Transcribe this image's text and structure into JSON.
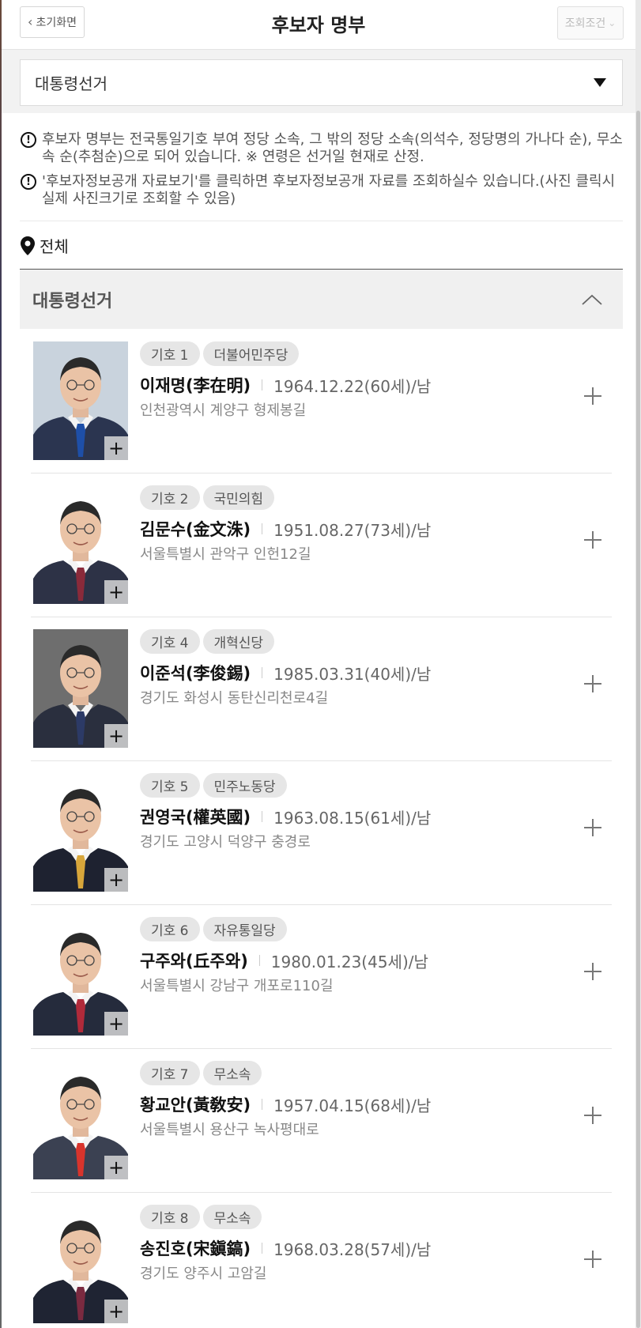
{
  "header": {
    "back_label": "초기화면",
    "title": "후보자 명부",
    "filter_label": "조회조건"
  },
  "election_select": {
    "value": "대통령선거"
  },
  "notices": [
    "후보자 명부는 전국통일기호 부여 정당 소속, 그 밖의 정당 소속(의석수, 정당명의 가나다 순), 무소속 순(추첨순)으로 되어 있습니다. ※ 연령은 선거일 현재로 산정.",
    "'후보자정보공개 자료보기'를 클릭하면 후보자정보공개 자료를 조회하실수 있습니다.(사진 클릭시 실제 사진크기로 조회할 수 있음)"
  ],
  "region": {
    "label": "전체"
  },
  "section": {
    "title": "대통령선거"
  },
  "candidates": [
    {
      "number": "기호 1",
      "party": "더불어민주당",
      "name": "이재명(李在明)",
      "birth": "1964.12.22(60세)/남",
      "address": "인천광역시 계양구 형제봉길",
      "suit": "#2b3550",
      "tie": "#1e4fa8",
      "bg": "#c9d3dd"
    },
    {
      "number": "기호 2",
      "party": "국민의힘",
      "name": "김문수(金文洙)",
      "birth": "1951.08.27(73세)/남",
      "address": "서울특별시 관악구 인헌12길",
      "suit": "#2d3246",
      "tie": "#8a2a3a",
      "bg": "#ffffff"
    },
    {
      "number": "기호 4",
      "party": "개혁신당",
      "name": "이준석(李俊錫)",
      "birth": "1985.03.31(40세)/남",
      "address": "경기도 화성시 동탄신리천로4길",
      "suit": "#2a2f3e",
      "tie": "#2c3a66",
      "bg": "#6e6e6e"
    },
    {
      "number": "기호 5",
      "party": "민주노동당",
      "name": "권영국(權英國)",
      "birth": "1963.08.15(61세)/남",
      "address": "경기도 고양시 덕양구 충경로",
      "suit": "#1e2230",
      "tie": "#d8a63a",
      "bg": "#ffffff"
    },
    {
      "number": "기호 6",
      "party": "자유통일당",
      "name": "구주와(丘주와)",
      "birth": "1980.01.23(45세)/남",
      "address": "서울특별시 강남구 개포로110길",
      "suit": "#252b3c",
      "tie": "#b02a3a",
      "bg": "#ffffff"
    },
    {
      "number": "기호 7",
      "party": "무소속",
      "name": "황교안(黃敎安)",
      "birth": "1957.04.15(68세)/남",
      "address": "서울특별시 용산구 녹사평대로",
      "suit": "#3b4152",
      "tie": "#d8342c",
      "bg": "#ffffff"
    },
    {
      "number": "기호 8",
      "party": "무소속",
      "name": "송진호(宋鎭鎬)",
      "birth": "1968.03.28(57세)/남",
      "address": "경기도 양주시 고암길",
      "suit": "#1f2433",
      "tie": "#7a2a40",
      "bg": "#ffffff"
    }
  ]
}
